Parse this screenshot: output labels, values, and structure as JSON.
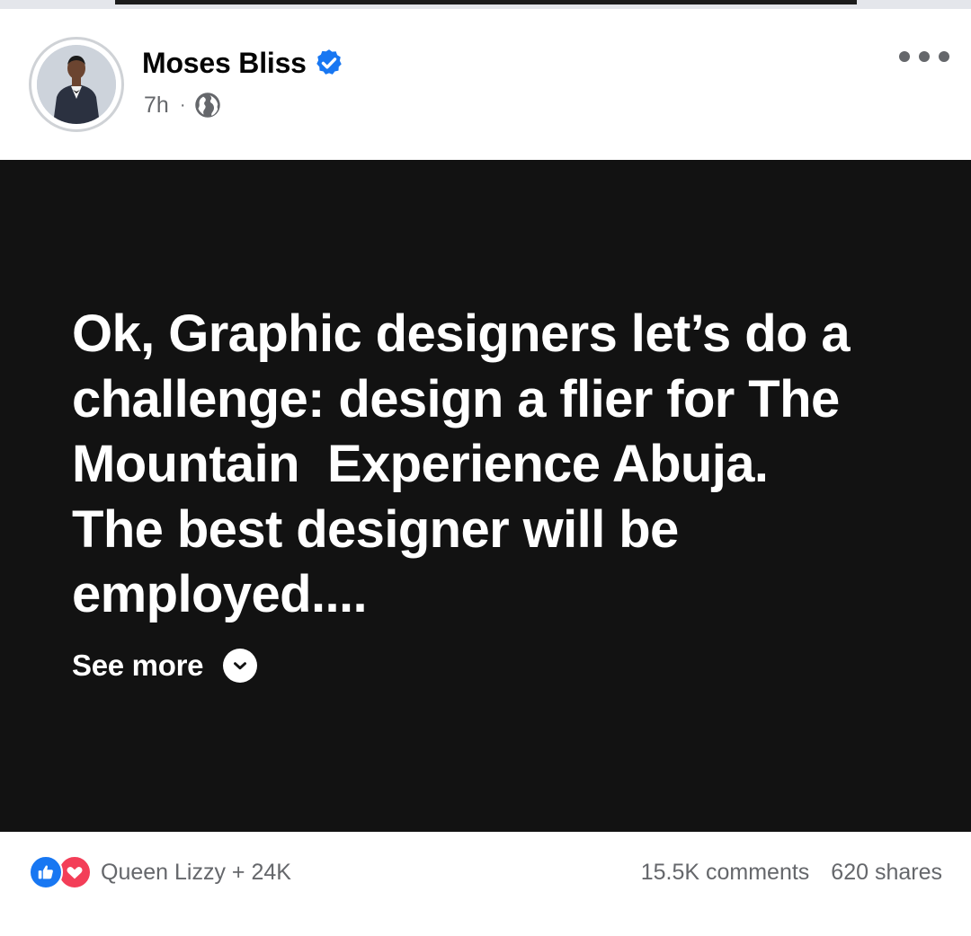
{
  "colors": {
    "post_background": "#121212",
    "post_text": "#ffffff",
    "meta_text": "#65676b",
    "verified_badge": "#1877f2",
    "like_reaction": "#1877f2",
    "love_reaction": "#f33e58"
  },
  "post": {
    "author": {
      "name": "Moses Bliss",
      "verified": true
    },
    "time": "7h",
    "separator": "·",
    "audience_icon": "globe-icon",
    "body": "Ok, Graphic designers let’s do a\nchallenge: design a flier for The\nMountain  Experience Abuja.\nThe best designer will be\nemployed....",
    "see_more_label": "See more"
  },
  "engagement": {
    "reaction_icons": [
      "like-icon",
      "love-icon"
    ],
    "reaction_summary": "Queen Lizzy + 24K",
    "comments": "15.5K comments",
    "shares": "620 shares"
  }
}
